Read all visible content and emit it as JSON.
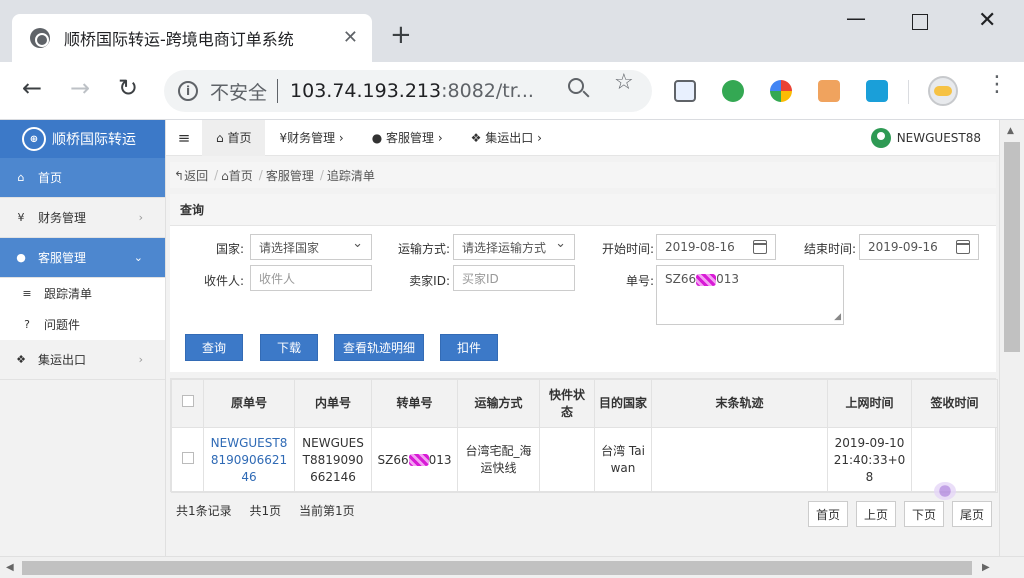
{
  "browser": {
    "tab_title": "顺桥国际转运-跨境电商订单系统",
    "security_label": "不安全",
    "url_host": "103.74.193.213",
    "url_rest": ":8082/tr...",
    "new_tab": "+",
    "tab_close": "✕"
  },
  "sidebar": {
    "brand": "顺桥国际转运",
    "items": [
      {
        "label": "首页",
        "icon": "home-icon"
      },
      {
        "label": "财务管理",
        "icon": "yen-icon"
      },
      {
        "label": "客服管理",
        "icon": "user-icon"
      },
      {
        "label": "集运出口",
        "icon": "cubes-icon"
      }
    ],
    "subitems": [
      {
        "label": "跟踪清单",
        "icon": "list-icon"
      },
      {
        "label": "问题件",
        "icon": "question-icon"
      }
    ]
  },
  "topnav": {
    "items": [
      "首页",
      "财务管理",
      "客服管理",
      "集运出口"
    ],
    "user": "NEWGUEST88"
  },
  "breadcrumb": [
    "返回",
    "首页",
    "客服管理",
    "追踪清单"
  ],
  "query": {
    "title": "查询",
    "country_label": "国家:",
    "country_value": "请选择国家",
    "shipping_label": "运输方式:",
    "shipping_value": "请选择运输方式",
    "start_label": "开始时间:",
    "start_value": "2019-08-16",
    "end_label": "结束时间:",
    "end_value": "2019-09-16",
    "recipient_label": "收件人:",
    "recipient_placeholder": "收件人",
    "buyer_label": "卖家ID:",
    "buyer_placeholder": "买家ID",
    "order_label": "单号:",
    "order_value_prefix": "SZ66",
    "order_value_suffix": "013"
  },
  "buttons": {
    "search": "查询",
    "download": "下载",
    "track_detail": "查看轨迹明细",
    "hold": "扣件"
  },
  "table": {
    "headers": [
      "原单号",
      "内单号",
      "转单号",
      "运输方式",
      "快件状态",
      "目的国家",
      "末条轨迹",
      "上网时间",
      "签收时间"
    ],
    "rows": [
      {
        "original": "NEWGUEST8819090662146",
        "internal": "NEWGUEST8819090662146",
        "transfer_prefix": "SZ66",
        "transfer_suffix": "013",
        "shipping": "台湾宅配_海运快线",
        "status": "",
        "country": "台湾 Taiwan",
        "last_track": "",
        "online_time": "2019-09-10 21:40:33+08",
        "signed_time": ""
      }
    ]
  },
  "pager": {
    "total_records": "共1条记录",
    "total_pages": "共1页",
    "current_page": "当前第1页",
    "first": "首页",
    "prev": "上页",
    "next": "下页",
    "last": "尾页"
  }
}
